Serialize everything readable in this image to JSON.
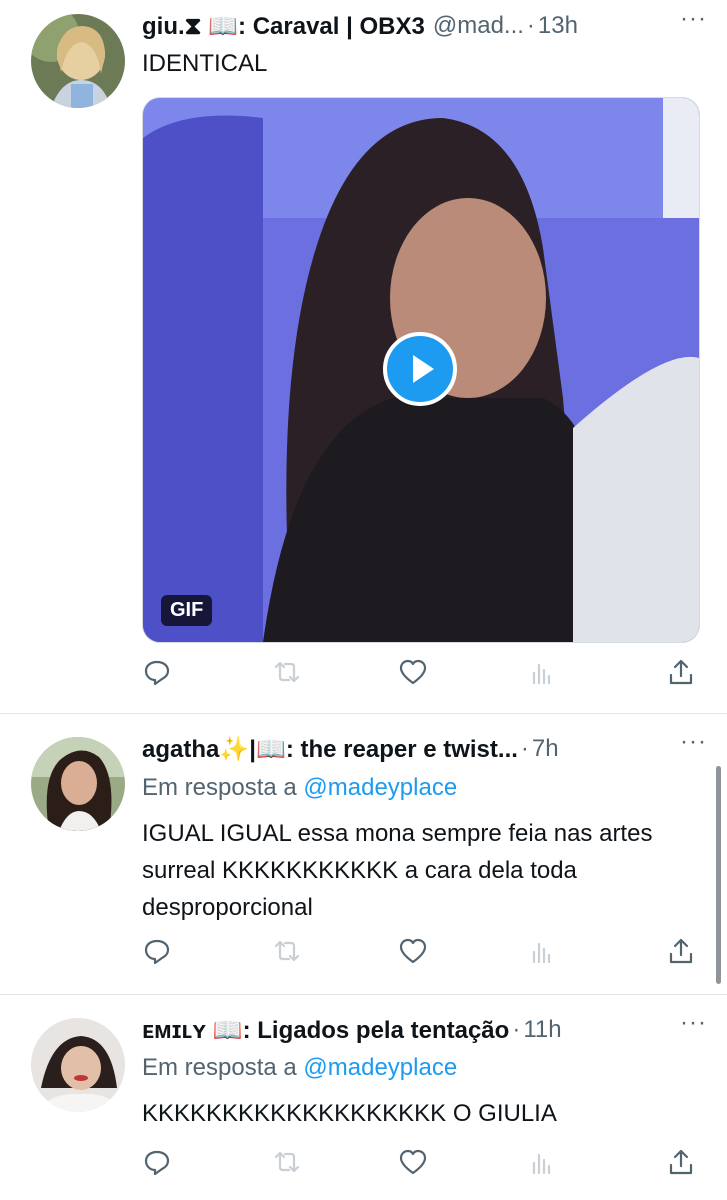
{
  "tweets": [
    {
      "name": "giu.⧗ 📖: Caraval | OBX3",
      "handle": "@mad...",
      "dot": "·",
      "time": "13h",
      "text": "IDENTICAL",
      "media_badge": "GIF",
      "more": "···"
    },
    {
      "name": "agatha✨|📖: the reaper e twist...",
      "dot": "·",
      "time": "7h",
      "reply_prefix": "Em resposta a",
      "reply_to": "@madeyplace",
      "text": "IGUAL IGUAL essa mona sempre feia nas artes surreal KKKKKKKKKKK a cara dela toda desproporcional",
      "more": "···"
    },
    {
      "name": "ᴇᴍɪʟʏ 📖: Ligados pela tentação",
      "dot": "·",
      "time": "11h",
      "reply_prefix": "Em resposta a",
      "reply_to": "@madeyplace",
      "text": "KKKKKKKKKKKKKKKKKKK O GIULIA",
      "more": "···"
    }
  ],
  "colors": {
    "accent": "#1d9bf0",
    "muted": "#536471",
    "text": "#0f1419"
  }
}
